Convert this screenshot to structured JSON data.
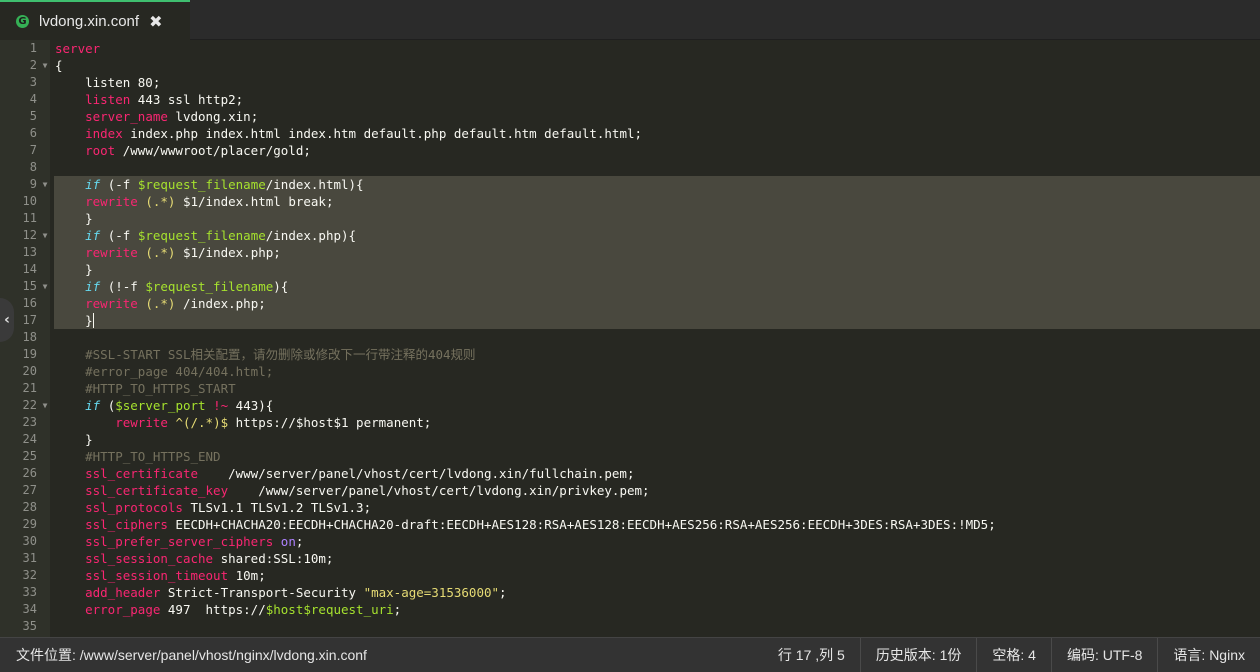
{
  "tab": {
    "icon_letter": "G",
    "title": "lvdong.xin.conf",
    "close_glyph": "✖"
  },
  "editor": {
    "cursor_line": 17,
    "lines": [
      {
        "n": "1",
        "fold": false,
        "sel": false,
        "tokens": [
          [
            "k",
            "server"
          ]
        ]
      },
      {
        "n": "2",
        "fold": true,
        "sel": false,
        "tokens": [
          [
            "",
            "{"
          ]
        ]
      },
      {
        "n": "3",
        "fold": false,
        "sel": false,
        "tokens": [
          [
            "",
            "    listen 80;"
          ]
        ]
      },
      {
        "n": "4",
        "fold": false,
        "sel": false,
        "tokens": [
          [
            "",
            "    "
          ],
          [
            "k",
            "listen"
          ],
          [
            "",
            " 443 ssl http2;"
          ]
        ]
      },
      {
        "n": "5",
        "fold": false,
        "sel": false,
        "tokens": [
          [
            "",
            "    "
          ],
          [
            "k",
            "server_name"
          ],
          [
            "",
            " lvdong.xin;"
          ]
        ]
      },
      {
        "n": "6",
        "fold": false,
        "sel": false,
        "tokens": [
          [
            "",
            "    "
          ],
          [
            "k",
            "index"
          ],
          [
            "",
            " index.php index.html index.htm default.php default.htm default.html;"
          ]
        ]
      },
      {
        "n": "7",
        "fold": false,
        "sel": false,
        "tokens": [
          [
            "",
            "    "
          ],
          [
            "k",
            "root"
          ],
          [
            "",
            " /www/wwwroot/placer/gold;"
          ]
        ]
      },
      {
        "n": "8",
        "fold": false,
        "sel": false,
        "tokens": []
      },
      {
        "n": "9",
        "fold": true,
        "sel": true,
        "tokens": [
          [
            "",
            "    "
          ],
          [
            "b",
            "if"
          ],
          [
            "",
            " (-f "
          ],
          [
            "v",
            "$request_filename"
          ],
          [
            "",
            "/index.html){"
          ]
        ]
      },
      {
        "n": "10",
        "fold": false,
        "sel": true,
        "tokens": [
          [
            "",
            "    "
          ],
          [
            "k",
            "rewrite"
          ],
          [
            "",
            " "
          ],
          [
            "s",
            "(.*)"
          ],
          [
            "",
            " $1/index.html break;"
          ]
        ]
      },
      {
        "n": "11",
        "fold": false,
        "sel": true,
        "tokens": [
          [
            "",
            "    }"
          ]
        ]
      },
      {
        "n": "12",
        "fold": true,
        "sel": true,
        "tokens": [
          [
            "",
            "    "
          ],
          [
            "b",
            "if"
          ],
          [
            "",
            " (-f "
          ],
          [
            "v",
            "$request_filename"
          ],
          [
            "",
            "/index.php){"
          ]
        ]
      },
      {
        "n": "13",
        "fold": false,
        "sel": true,
        "tokens": [
          [
            "",
            "    "
          ],
          [
            "k",
            "rewrite"
          ],
          [
            "",
            " "
          ],
          [
            "s",
            "(.*)"
          ],
          [
            "",
            " $1/index.php;"
          ]
        ]
      },
      {
        "n": "14",
        "fold": false,
        "sel": true,
        "tokens": [
          [
            "",
            "    }"
          ]
        ]
      },
      {
        "n": "15",
        "fold": true,
        "sel": true,
        "tokens": [
          [
            "",
            "    "
          ],
          [
            "b",
            "if"
          ],
          [
            "",
            " (!-f "
          ],
          [
            "v",
            "$request_filename"
          ],
          [
            "",
            "){"
          ]
        ]
      },
      {
        "n": "16",
        "fold": false,
        "sel": true,
        "tokens": [
          [
            "",
            "    "
          ],
          [
            "k",
            "rewrite"
          ],
          [
            "",
            " "
          ],
          [
            "s",
            "(.*)"
          ],
          [
            "",
            " /index.php;"
          ]
        ]
      },
      {
        "n": "17",
        "fold": false,
        "sel": true,
        "tokens": [
          [
            "",
            "    }"
          ]
        ]
      },
      {
        "n": "18",
        "fold": false,
        "sel": false,
        "tokens": []
      },
      {
        "n": "19",
        "fold": false,
        "sel": false,
        "tokens": [
          [
            "",
            "    "
          ],
          [
            "c",
            "#SSL-START SSL相关配置，请勿删除或修改下一行带注释的404规则"
          ]
        ]
      },
      {
        "n": "20",
        "fold": false,
        "sel": false,
        "tokens": [
          [
            "",
            "    "
          ],
          [
            "c",
            "#error_page 404/404.html;"
          ]
        ]
      },
      {
        "n": "21",
        "fold": false,
        "sel": false,
        "tokens": [
          [
            "",
            "    "
          ],
          [
            "c",
            "#HTTP_TO_HTTPS_START"
          ]
        ]
      },
      {
        "n": "22",
        "fold": true,
        "sel": false,
        "tokens": [
          [
            "",
            "    "
          ],
          [
            "b",
            "if"
          ],
          [
            "",
            " ("
          ],
          [
            "v",
            "$server_port"
          ],
          [
            "",
            " "
          ],
          [
            "k",
            "!~"
          ],
          [
            "",
            " 443){"
          ]
        ]
      },
      {
        "n": "23",
        "fold": false,
        "sel": false,
        "tokens": [
          [
            "",
            "        "
          ],
          [
            "k",
            "rewrite"
          ],
          [
            "",
            " "
          ],
          [
            "s",
            "^(/.*)$"
          ],
          [
            "",
            " https://$host$1 permanent;"
          ]
        ]
      },
      {
        "n": "24",
        "fold": false,
        "sel": false,
        "tokens": [
          [
            "",
            "    }"
          ]
        ]
      },
      {
        "n": "25",
        "fold": false,
        "sel": false,
        "tokens": [
          [
            "",
            "    "
          ],
          [
            "c",
            "#HTTP_TO_HTTPS_END"
          ]
        ]
      },
      {
        "n": "26",
        "fold": false,
        "sel": false,
        "tokens": [
          [
            "",
            "    "
          ],
          [
            "k",
            "ssl_certificate"
          ],
          [
            "",
            "    /www/server/panel/vhost/cert/lvdong.xin/fullchain.pem;"
          ]
        ]
      },
      {
        "n": "27",
        "fold": false,
        "sel": false,
        "tokens": [
          [
            "",
            "    "
          ],
          [
            "k",
            "ssl_certificate_key"
          ],
          [
            "",
            "    /www/server/panel/vhost/cert/lvdong.xin/privkey.pem;"
          ]
        ]
      },
      {
        "n": "28",
        "fold": false,
        "sel": false,
        "tokens": [
          [
            "",
            "    "
          ],
          [
            "k",
            "ssl_protocols"
          ],
          [
            "",
            " TLSv1.1 TLSv1.2 TLSv1.3;"
          ]
        ]
      },
      {
        "n": "29",
        "fold": false,
        "sel": false,
        "tokens": [
          [
            "",
            "    "
          ],
          [
            "k",
            "ssl_ciphers"
          ],
          [
            "",
            " EECDH+CHACHA20:EECDH+CHACHA20-draft:EECDH+AES128:RSA+AES128:EECDH+AES256:RSA+AES256:EECDH+3DES:RSA+3DES:!MD5;"
          ]
        ]
      },
      {
        "n": "30",
        "fold": false,
        "sel": false,
        "tokens": [
          [
            "",
            "    "
          ],
          [
            "k",
            "ssl_prefer_server_ciphers"
          ],
          [
            "",
            " "
          ],
          [
            "o",
            "on"
          ],
          [
            "",
            ";"
          ]
        ]
      },
      {
        "n": "31",
        "fold": false,
        "sel": false,
        "tokens": [
          [
            "",
            "    "
          ],
          [
            "k",
            "ssl_session_cache"
          ],
          [
            "",
            " shared:SSL:10m;"
          ]
        ]
      },
      {
        "n": "32",
        "fold": false,
        "sel": false,
        "tokens": [
          [
            "",
            "    "
          ],
          [
            "k",
            "ssl_session_timeout"
          ],
          [
            "",
            " 10m;"
          ]
        ]
      },
      {
        "n": "33",
        "fold": false,
        "sel": false,
        "tokens": [
          [
            "",
            "    "
          ],
          [
            "k",
            "add_header"
          ],
          [
            "",
            " Strict-Transport-Security "
          ],
          [
            "s",
            "\"max-age=31536000\""
          ],
          [
            "",
            ";"
          ]
        ]
      },
      {
        "n": "34",
        "fold": false,
        "sel": false,
        "tokens": [
          [
            "",
            "    "
          ],
          [
            "k",
            "error_page"
          ],
          [
            "",
            " 497  https://"
          ],
          [
            "v",
            "$host$request_uri"
          ],
          [
            "",
            ";"
          ]
        ]
      },
      {
        "n": "35",
        "fold": false,
        "sel": false,
        "tokens": []
      }
    ]
  },
  "side_toggle_glyph": "‹",
  "statusbar": {
    "path": "文件位置: /www/server/panel/vhost/nginx/lvdong.xin.conf",
    "position": "行 17 ,列 5",
    "history": "历史版本: 1份",
    "indent": "空格: 4",
    "encoding": "编码: UTF-8",
    "language": "语言: Nginx"
  }
}
